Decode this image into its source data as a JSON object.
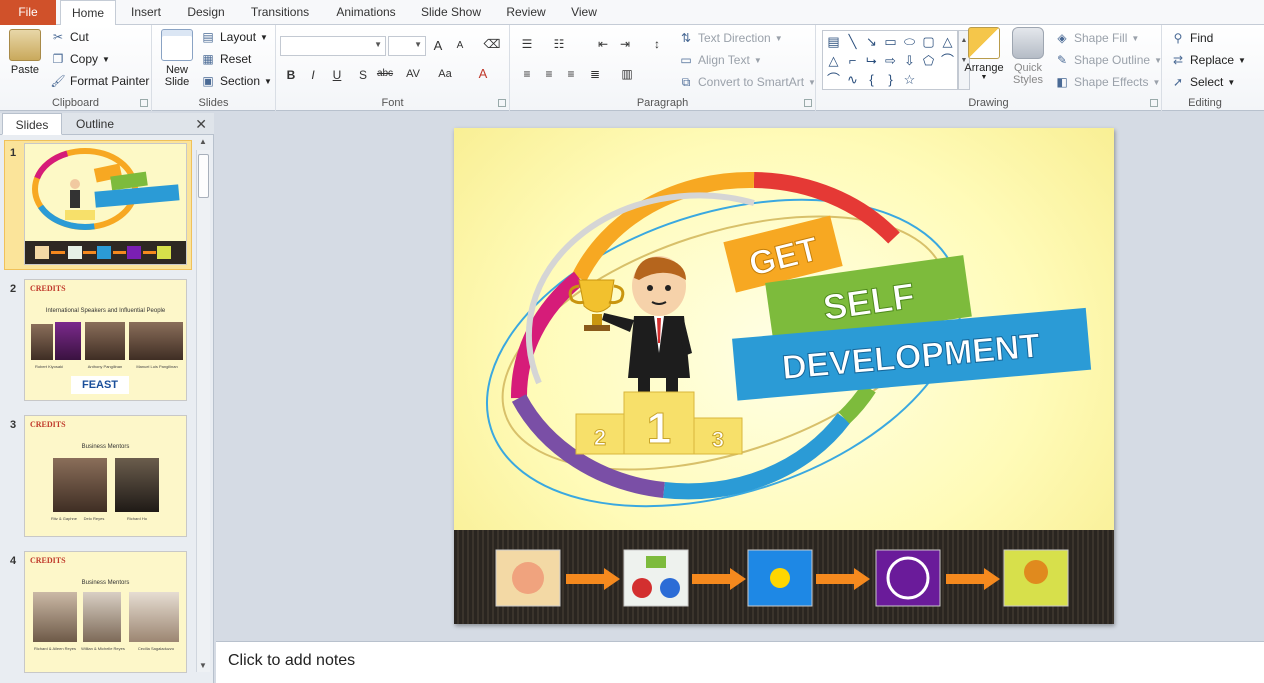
{
  "tabs": {
    "file": "File",
    "items": [
      "Home",
      "Insert",
      "Design",
      "Transitions",
      "Animations",
      "Slide Show",
      "Review",
      "View"
    ],
    "active": "Home"
  },
  "ribbon": {
    "clipboard": {
      "label": "Clipboard",
      "paste": "Paste",
      "cut": "Cut",
      "copy": "Copy",
      "format_painter": "Format Painter"
    },
    "slides": {
      "label": "Slides",
      "new_slide_line1": "New",
      "new_slide_line2": "Slide",
      "layout": "Layout",
      "reset": "Reset",
      "section": "Section"
    },
    "font": {
      "label": "Font",
      "bold": "B",
      "italic": "I",
      "underline": "U",
      "shadow": "S",
      "strike": "abc",
      "spacing": "AV",
      "case": "Aa",
      "grow": "A",
      "shrink": "A",
      "color": "A"
    },
    "paragraph": {
      "label": "Paragraph",
      "text_direction": "Text Direction",
      "align_text": "Align Text",
      "convert_smartart": "Convert to SmartArt"
    },
    "drawing": {
      "label": "Drawing",
      "arrange": "Arrange",
      "quick_styles_line1": "Quick",
      "quick_styles_line2": "Styles",
      "shape_fill": "Shape Fill",
      "shape_outline": "Shape Outline",
      "shape_effects": "Shape Effects"
    },
    "editing": {
      "label": "Editing",
      "find": "Find",
      "replace": "Replace",
      "select": "Select"
    }
  },
  "left_panel": {
    "tabs": [
      "Slides",
      "Outline"
    ],
    "active_tab": "Slides",
    "slides": [
      {
        "number": "1"
      },
      {
        "number": "2",
        "heading": "CREDITS",
        "subtitle": "International Speakers and Influential People",
        "captions": [
          "Robert Kiyosaki",
          "Anthony Pangilinan",
          "Manuel Luis Pangilinan"
        ],
        "logo": "FEAST"
      },
      {
        "number": "3",
        "heading": "CREDITS",
        "subtitle": "Business Mentors",
        "captions": [
          "Ritz & Gaphne",
          "Delo Reyes",
          "Richard Ho"
        ]
      },
      {
        "number": "4",
        "heading": "CREDITS",
        "subtitle": "Business Mentors",
        "captions": [
          "Richard & Aileen Reyes",
          "Willian & Michelle Reyes",
          "Cecilia Sagaladuzzo"
        ]
      }
    ]
  },
  "slide": {
    "word1": "GET",
    "word2": "SELF",
    "word3": "DEVELOPMENT",
    "podium": [
      "2",
      "1",
      "3"
    ],
    "colors": {
      "orange": "#f7a822",
      "green": "#7dbb3c",
      "blue": "#2b9bd6",
      "red": "#e53935",
      "magenta": "#d61c79",
      "purple": "#7a4fa6"
    }
  },
  "notes": {
    "placeholder": "Click to add notes"
  }
}
